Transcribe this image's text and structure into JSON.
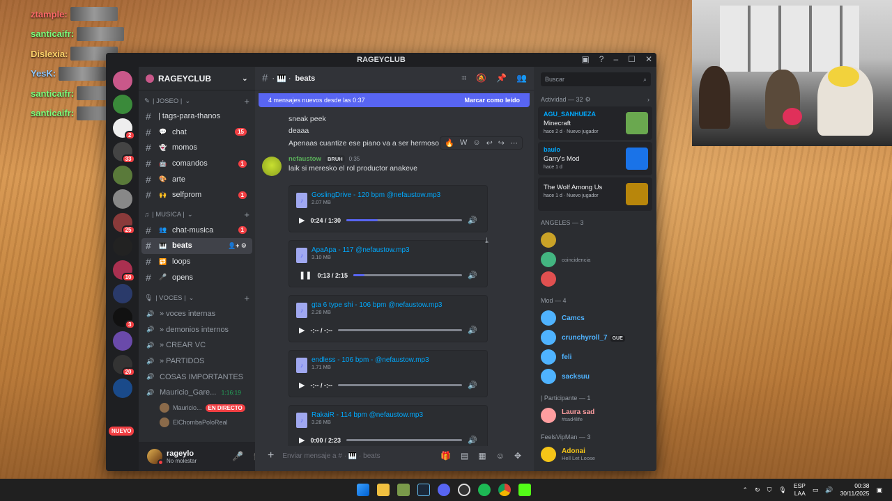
{
  "overlay_chat": [
    {
      "user": "ztample:",
      "color": "#ff6a6a"
    },
    {
      "user": "santicaifr:",
      "color": "#7cff7c"
    },
    {
      "user": "Dislexia:",
      "color": "#ffd36a"
    },
    {
      "user": "YesK:",
      "color": "#8fc8ff"
    },
    {
      "user": "santicaifr:",
      "color": "#7cff7c"
    },
    {
      "user": "santicaifr:",
      "color": "#7cff7c"
    }
  ],
  "window": {
    "title": "RAGEYCLUB"
  },
  "server": {
    "name": "RAGEYCLUB",
    "new_label": "NUEVO"
  },
  "guild_badges": [
    "",
    "",
    "2",
    "33",
    "",
    "",
    "25",
    "",
    "10",
    "",
    "3",
    "",
    "20",
    ""
  ],
  "categories": {
    "joseo": "| JOSEO |",
    "musica": "| MUSICA |",
    "voces": "| VOCES |"
  },
  "channels": [
    {
      "name": "| tags-para-thanos",
      "icon": "",
      "badge": ""
    },
    {
      "name": "chat",
      "icon": "💬",
      "badge": "15"
    },
    {
      "name": "momos",
      "icon": "👻",
      "badge": ""
    },
    {
      "name": "comandos",
      "icon": "🤖",
      "badge": "1"
    },
    {
      "name": "arte",
      "icon": "🎨",
      "badge": ""
    },
    {
      "name": "selfprom",
      "icon": "🙌",
      "badge": "1"
    }
  ],
  "music_channels": [
    {
      "name": "chat-musica",
      "icon": "👥",
      "badge": "1",
      "selected": false
    },
    {
      "name": "beats",
      "icon": "🎹",
      "badge": "",
      "selected": true
    },
    {
      "name": "loops",
      "icon": "🔁",
      "badge": "",
      "selected": false
    },
    {
      "name": "opens",
      "icon": "🎤",
      "badge": "",
      "selected": false
    }
  ],
  "voice_channels": [
    {
      "name": "» voces internas"
    },
    {
      "name": "» demonios internos"
    },
    {
      "name": "» CREAR VC"
    },
    {
      "name": "» PARTIDOS"
    },
    {
      "name": "COSAS IMPORTANTES"
    },
    {
      "name": "Mauricio_Gare...",
      "timer": "1:16:19"
    }
  ],
  "voice_users": [
    {
      "name": "Mauricio...",
      "live": "EN DIRECTO"
    },
    {
      "name": "ElChombaPoloReal",
      "live": ""
    }
  ],
  "user_panel": {
    "name": "rageylo",
    "status": "No molestar"
  },
  "channel_header": {
    "name": "beats"
  },
  "new_messages": {
    "text": "4 mensajes nuevos desde las 0:37",
    "mark": "Marcar como leído"
  },
  "messages_prev": [
    "sneak peek",
    "deaaa",
    "Apenaas cuantize ese piano va a ser hermoso"
  ],
  "post": {
    "author": "nefaustow",
    "tag": "BRUH",
    "time": "0:35",
    "text": "laik si meresko el rol productor anakeve"
  },
  "attachments": [
    {
      "file": "GoslingDrive - 120 bpm @nefaustow.mp3",
      "size": "2.07 MB",
      "time": "0:24 / 1:30",
      "progress": 0.27,
      "playing": false
    },
    {
      "file": "ApaApa - 117 @nefaustow.mp3",
      "size": "3.10 MB",
      "time": "0:13 / 2:15",
      "progress": 0.1,
      "playing": true
    },
    {
      "file": "gta 6 type shi - 106 bpm @nefaustow.mp3",
      "size": "2.28 MB",
      "time": "-:-- / -:--",
      "progress": 0,
      "playing": false
    },
    {
      "file": "endless - 106 bpm - @nefaustow.mp3",
      "size": "1.71 MB",
      "time": "-:-- / -:--",
      "progress": 0,
      "playing": false
    },
    {
      "file": "RakaiR - 114 bpm @nefaustow.mp3",
      "size": "3.28 MB",
      "time": "0:00 / 2:23",
      "progress": 0,
      "playing": false
    }
  ],
  "composer": {
    "placeholder": "Enviar mensaje a # · 🎹 · beats"
  },
  "members": {
    "search": "Buscar",
    "activity_header": "Actividad — 32",
    "activities": [
      {
        "user": "AGU_SANHUEZA",
        "game": "Minecraft",
        "meta": "hace 2 d · Nuevo jugador",
        "color": "#6aa84f"
      },
      {
        "user": "baulo",
        "game": "Garry's Mod",
        "meta": "hace 1 d",
        "color": "#1a73e8"
      },
      {
        "user": "",
        "game": "The Wolf Among Us",
        "meta": "hace 1 d · Nuevo jugador",
        "color": "#b8860b"
      }
    ],
    "sections": [
      {
        "title": "ANGELES — 3",
        "items": [
          {
            "name": "",
            "sub": "",
            "color": "#c9a227"
          },
          {
            "name": "",
            "sub": "coincidencia",
            "color": "#43b581"
          },
          {
            "name": "",
            "sub": "",
            "color": "#e05050"
          }
        ]
      },
      {
        "title": "Mod — 4",
        "items": [
          {
            "name": "Camcs",
            "sub": "",
            "color": "#4fb3ff",
            "tag": ""
          },
          {
            "name": "crunchyroll_7",
            "sub": "",
            "color": "#4fb3ff",
            "tag": "GUE"
          },
          {
            "name": "feli",
            "sub": "",
            "color": "#4fb3ff",
            "tag": ""
          },
          {
            "name": "sacksuu",
            "sub": "",
            "color": "#4fb3ff",
            "tag": ""
          }
        ]
      },
      {
        "title": "| Participante — 1",
        "items": [
          {
            "name": "Laura sad",
            "sub": "#sad4life",
            "color": "#ff9ea0",
            "tag": ""
          }
        ]
      },
      {
        "title": "FeelsVipMan — 3",
        "items": [
          {
            "name": "Adonai",
            "sub": "Hell Let Loose",
            "color": "#f5c518",
            "tag": ""
          }
        ]
      }
    ]
  },
  "taskbar": {
    "lang": "ESP",
    "layout": "LAA",
    "time": "00:38",
    "date": "30/11/2025"
  }
}
